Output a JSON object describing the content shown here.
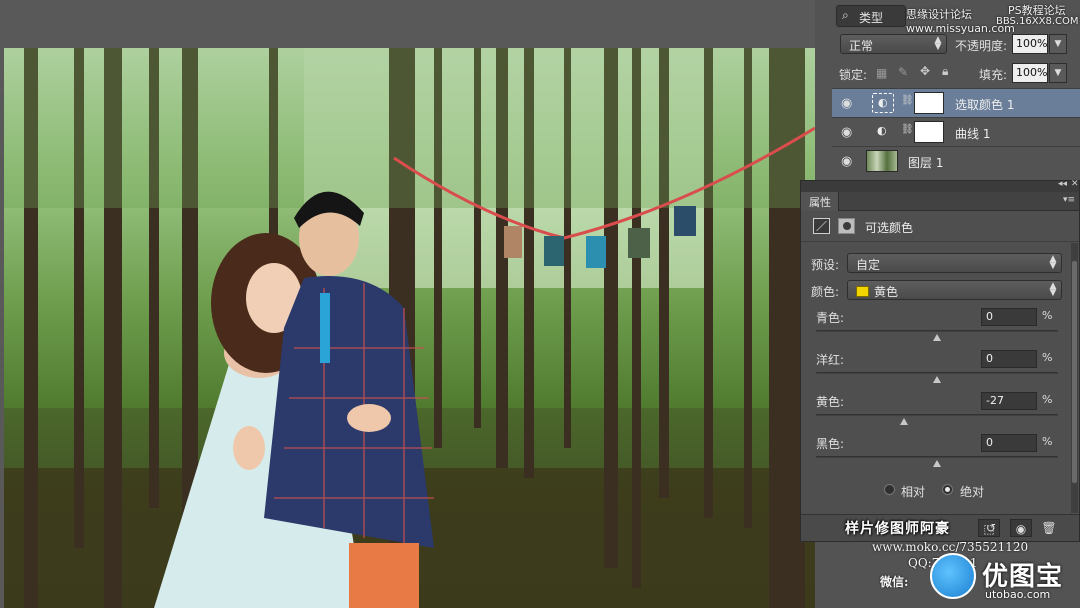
{
  "layers_panel": {
    "filter_label": "类型",
    "blend_mode": "正常",
    "opacity_label": "不透明度:",
    "opacity_value": "100%",
    "lock_label": "锁定:",
    "fill_label": "填充:",
    "fill_value": "100%",
    "watermark_top": "思缘设计论坛 www.missyuan.com",
    "watermark_top2": "PS教程论坛",
    "watermark_top3": "BBS.16XX8.COM",
    "layers": [
      {
        "name": "选取颜色 1",
        "selected": true
      },
      {
        "name": "曲线 1",
        "selected": false
      },
      {
        "name": "图层 1",
        "selected": false
      }
    ]
  },
  "properties_panel": {
    "tab_label": "属性",
    "title": "可选颜色",
    "preset_label": "预设:",
    "preset_value": "自定",
    "color_label": "颜色:",
    "color_value": "黄色",
    "color_swatch": "#f2d400",
    "sliders": [
      {
        "label": "青色:",
        "value": "0",
        "unit": "%",
        "level": 0
      },
      {
        "label": "洋红:",
        "value": "0",
        "unit": "%",
        "level": 0
      },
      {
        "label": "黄色:",
        "value": "-27",
        "unit": "%",
        "level": -27
      },
      {
        "label": "黑色:",
        "value": "0",
        "unit": "%",
        "level": 0
      }
    ],
    "method_relative": "相对",
    "method_absolute": "绝对",
    "method_selected": "绝对",
    "bottom_watermark": "样片修图师阿豪"
  },
  "watermark_bottom": {
    "url": "www.moko.cc/735521120",
    "qq": "QQ:735521",
    "wechat": "微信:",
    "logo_main": "优图宝",
    "logo_sub": "utobao.com"
  }
}
